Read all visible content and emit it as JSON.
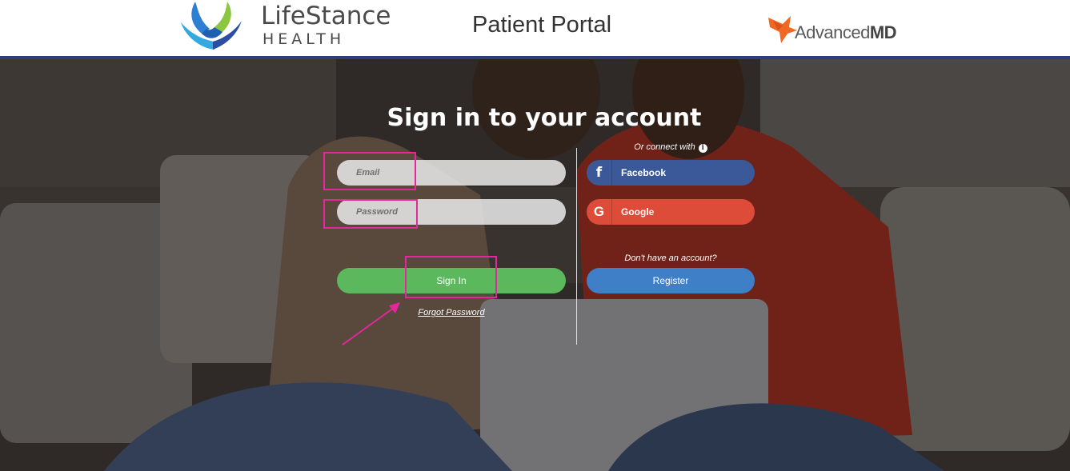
{
  "header": {
    "brand_name": "LifeStance",
    "brand_sub": "HEALTH",
    "portal_title": "Patient Portal",
    "partner_prefix": "Advanced",
    "partner_suffix": "MD"
  },
  "login": {
    "title": "Sign in to your account",
    "email_placeholder": "Email",
    "password_placeholder": "Password",
    "sign_in_label": "Sign In",
    "forgot_label": "Forgot Password"
  },
  "social": {
    "connect_label": "Or connect with",
    "info_glyph": "i",
    "facebook_glyph": "f",
    "facebook_label": "Facebook",
    "google_glyph": "G",
    "google_label": "Google"
  },
  "register": {
    "prompt": "Don't have an account?",
    "label": "Register"
  },
  "colors": {
    "brand_bar": "#2f3e7a",
    "sign_in": "#5cb85c",
    "register": "#3f7fc8",
    "facebook": "#3b5998",
    "google": "#dd4b39",
    "highlight": "#e4289b"
  }
}
